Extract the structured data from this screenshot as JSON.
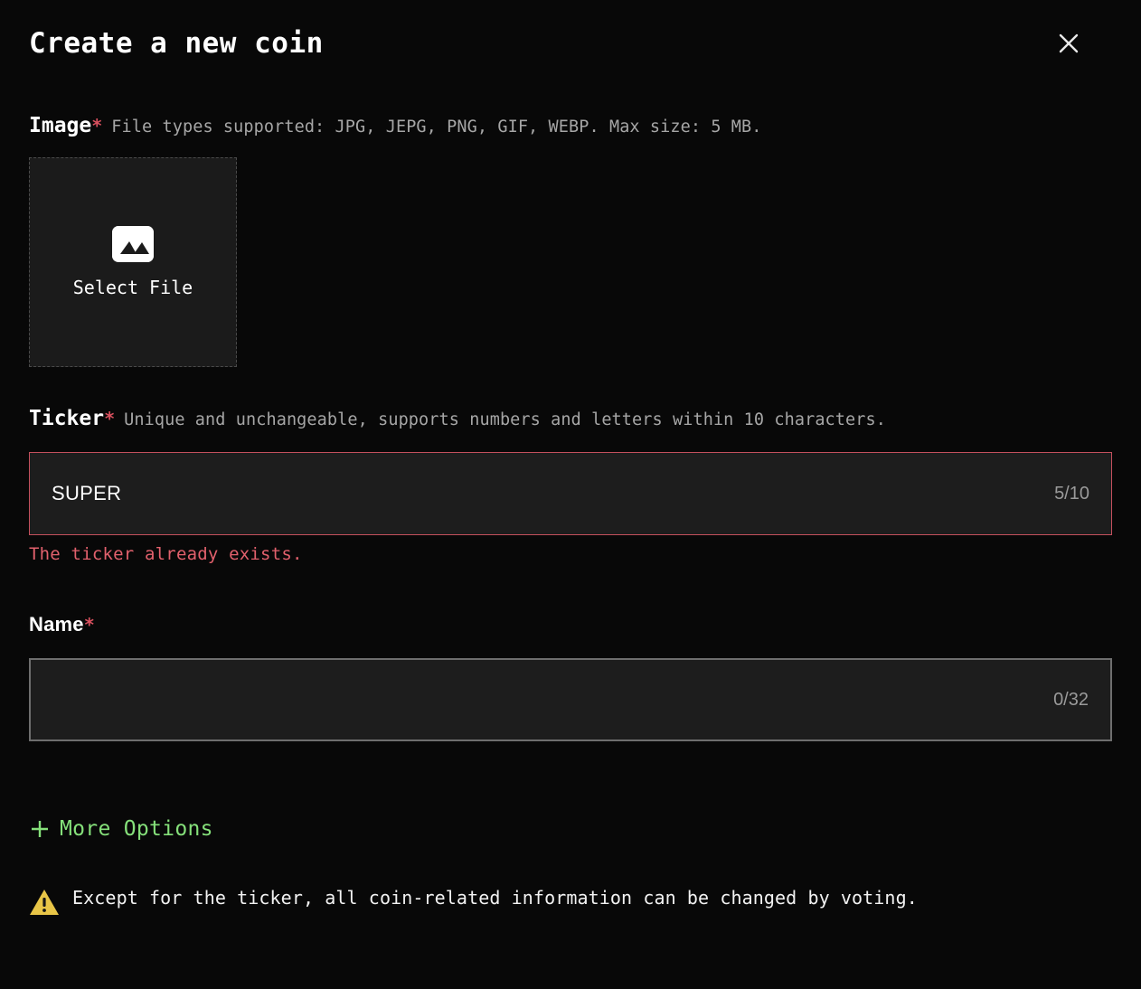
{
  "modal": {
    "title": "Create a new coin",
    "close_icon": "close-icon"
  },
  "image_field": {
    "label": "Image",
    "required_mark": "*",
    "hint": "File types supported: JPG, JEPG, PNG, GIF, WEBP. Max size: 5 MB.",
    "dropzone_label": "Select File",
    "dropzone_icon": "image-placeholder-icon"
  },
  "ticker_field": {
    "label": "Ticker",
    "required_mark": "*",
    "hint": "Unique and unchangeable, supports numbers and letters within 10 characters.",
    "value": "SUPER",
    "placeholder": "",
    "counter": "5/10",
    "error": "The ticker already exists.",
    "border_color": "#c4505d"
  },
  "name_field": {
    "label": "Name",
    "required_mark": "*",
    "value": "",
    "placeholder": "",
    "counter": "0/32",
    "border_color": "#6e6e6e"
  },
  "more_options": {
    "label": "More Options",
    "icon": "plus-icon",
    "color": "#85e07a"
  },
  "notice": {
    "icon": "warning-triangle-icon",
    "text": "Except for the ticker, all coin-related information can be changed by voting.",
    "icon_color": "#e8c547"
  }
}
